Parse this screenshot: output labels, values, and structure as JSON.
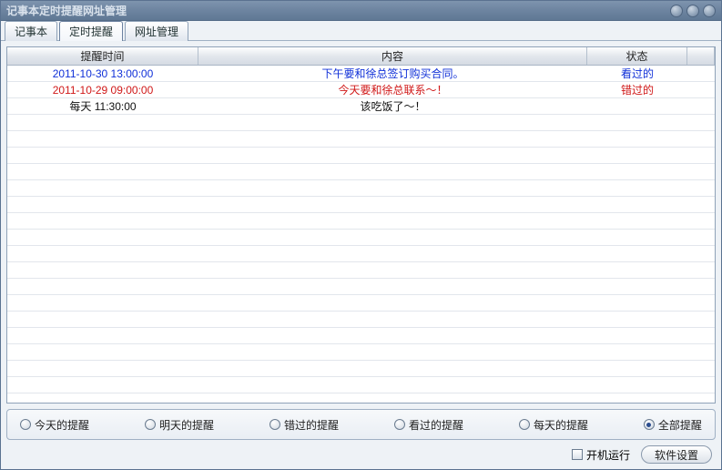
{
  "window": {
    "title": "记事本定时提醒网址管理"
  },
  "tabs": [
    {
      "label": "记事本",
      "active": false
    },
    {
      "label": "定时提醒",
      "active": true
    },
    {
      "label": "网址管理",
      "active": false
    }
  ],
  "table": {
    "headers": {
      "time": "提醒时间",
      "body": "内容",
      "status": "状态"
    },
    "rows": [
      {
        "time": "2011-10-30 13:00:00",
        "body": "下午要和徐总签订购买合同。",
        "status": "看过的",
        "color": "blue"
      },
      {
        "time": "2011-10-29 09:00:00",
        "body": "今天要和徐总联系～！",
        "status": "错过的",
        "color": "red"
      },
      {
        "time": "每天  11:30:00",
        "body": "该吃饭了～！",
        "status": "",
        "color": "black"
      }
    ],
    "empty_row_count": 19
  },
  "filters": [
    {
      "label": "今天的提醒",
      "selected": false
    },
    {
      "label": "明天的提醒",
      "selected": false
    },
    {
      "label": "错过的提醒",
      "selected": false
    },
    {
      "label": "看过的提醒",
      "selected": false
    },
    {
      "label": "每天的提醒",
      "selected": false
    },
    {
      "label": "全部提醒",
      "selected": true
    }
  ],
  "bottom": {
    "autorun_label": "开机运行",
    "settings_button": "软件设置"
  }
}
